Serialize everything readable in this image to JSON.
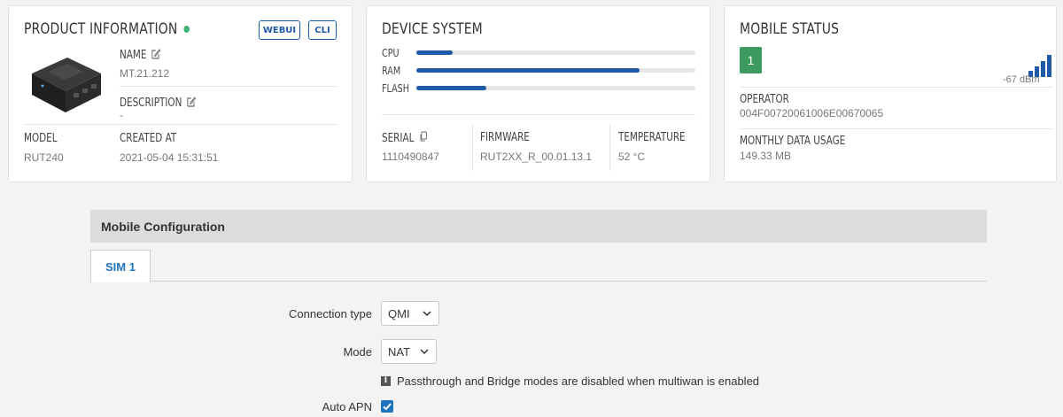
{
  "product": {
    "title": "PRODUCT INFORMATION",
    "webui_label": "WEBUI",
    "cli_label": "CLI",
    "name_label": "NAME",
    "name_value": "MT.21.212",
    "description_label": "DESCRIPTION",
    "description_value": "-",
    "model_label": "MODEL",
    "model_value": "RUT240",
    "created_label": "CREATED AT",
    "created_value": "2021-05-04 15:31:51",
    "status_color": "#3cb371"
  },
  "device": {
    "title": "DEVICE SYSTEM",
    "cpu_label": "CPU",
    "cpu_usage": 0.13,
    "ram_label": "RAM",
    "ram_usage": 0.8,
    "flash_label": "FLASH",
    "flash_usage": 0.25,
    "serial_label": "SERIAL",
    "serial_value": "1110490847",
    "firmware_label": "FIRMWARE",
    "firmware_value": "RUT2XX_R_00.01.13.1",
    "temperature_label": "TEMPERATURE",
    "temperature_value": "52 °C",
    "bar_color": "#1e5aa8"
  },
  "mobile": {
    "title": "MOBILE STATUS",
    "sim_number": "1",
    "signal_value": "-67 dBm",
    "operator_label": "OPERATOR",
    "operator_value": "004F00720061006E00670065",
    "usage_label": "MONTHLY DATA USAGE",
    "usage_value": "149.33 MB",
    "sim_color": "#3c9a5f"
  },
  "config": {
    "section_title": "Mobile Configuration",
    "tab_sim1": "SIM 1",
    "connection_type_label": "Connection type",
    "connection_type_value": "QMI",
    "mode_label": "Mode",
    "mode_value": "NAT",
    "mode_hint": "Passthrough and Bridge modes are disabled when multiwan is enabled",
    "auto_apn_label": "Auto APN",
    "auto_apn_checked": true
  }
}
